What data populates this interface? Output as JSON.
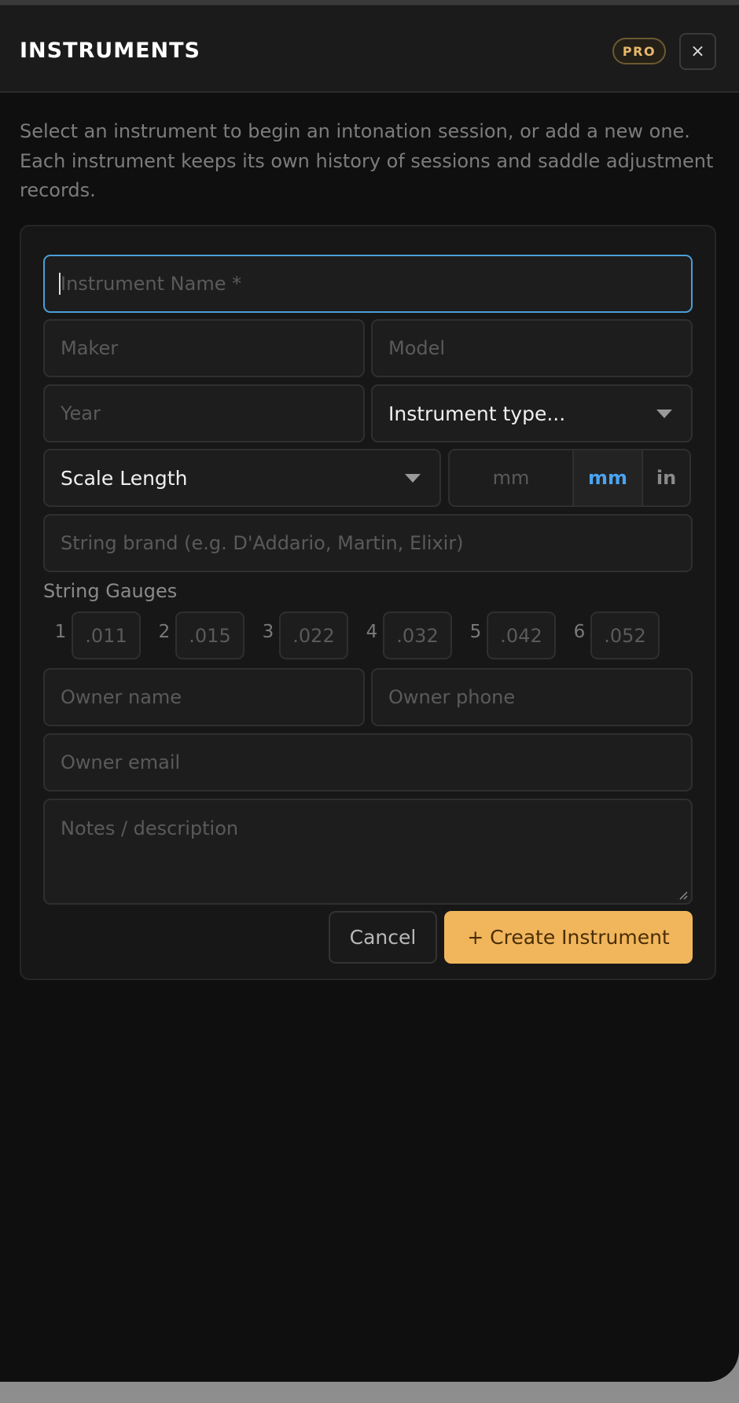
{
  "header": {
    "title": "INSTRUMENTS",
    "badge": "PRO",
    "close_label": "×"
  },
  "intro_text": "Select an instrument to begin an intonation session, or add a new one. Each instrument keeps its own history of sessions and saddle adjustment records.",
  "form": {
    "instrument_name": {
      "value": "",
      "placeholder": "Instrument Name *"
    },
    "maker": {
      "value": "",
      "placeholder": "Maker"
    },
    "model": {
      "value": "",
      "placeholder": "Model"
    },
    "year": {
      "value": "",
      "placeholder": "Year"
    },
    "instrument_type": {
      "selected": "Instrument type..."
    },
    "scale_length": {
      "selected": "Scale Length"
    },
    "scale_value": {
      "value": "",
      "placeholder": "mm"
    },
    "units": {
      "options": [
        "mm",
        "in"
      ],
      "active": "mm"
    },
    "string_brand": {
      "value": "",
      "placeholder": "String brand (e.g. D'Addario, Martin, Elixir)"
    },
    "string_gauges": {
      "label": "String Gauges",
      "items": [
        {
          "number": "1",
          "placeholder": ".011"
        },
        {
          "number": "2",
          "placeholder": ".015"
        },
        {
          "number": "3",
          "placeholder": ".022"
        },
        {
          "number": "4",
          "placeholder": ".032"
        },
        {
          "number": "5",
          "placeholder": ".042"
        },
        {
          "number": "6",
          "placeholder": ".052"
        }
      ]
    },
    "owner_name": {
      "value": "",
      "placeholder": "Owner name"
    },
    "owner_phone": {
      "value": "",
      "placeholder": "Owner phone"
    },
    "owner_email": {
      "value": "",
      "placeholder": "Owner email"
    },
    "notes": {
      "value": "",
      "placeholder": "Notes / description"
    },
    "cancel_label": "Cancel",
    "create_label": "+ Create Instrument"
  },
  "colors": {
    "accent": "#f1b65c",
    "focus": "#4a9fd8",
    "unit_active": "#4aa3f0",
    "badge": "#e8b86a"
  },
  "icons": {
    "close": "close-icon",
    "dropdown": "chevron-down-icon"
  }
}
